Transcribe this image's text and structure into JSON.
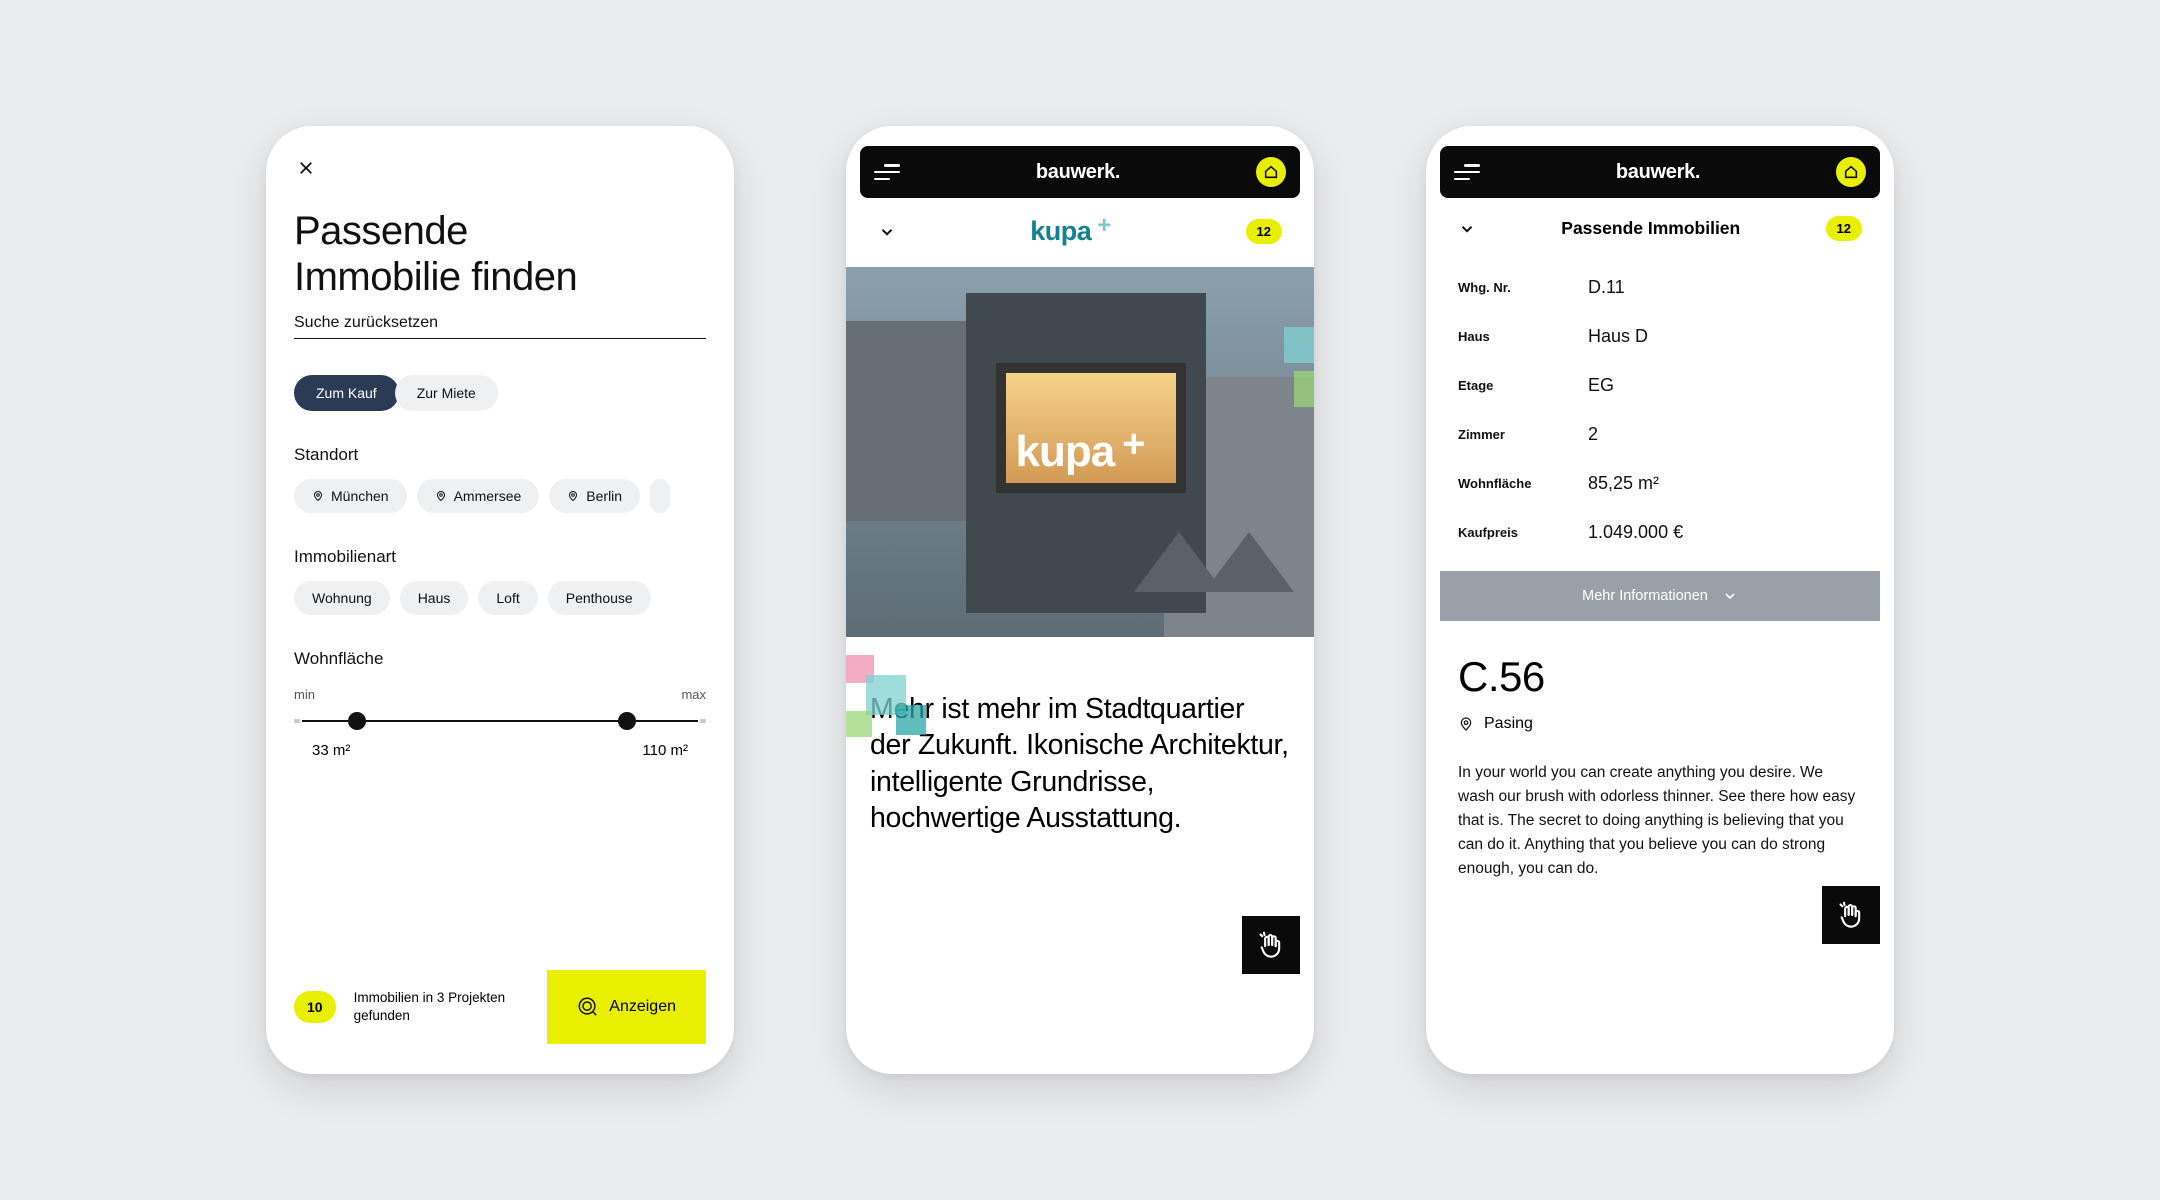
{
  "brand": "bauwerk.",
  "accent": "#e9ef00",
  "phone1": {
    "title_line1": "Passende",
    "title_line2": "Immobilie finden",
    "reset": "Suche zurücksetzen",
    "toggle_buy": "Zum Kauf",
    "toggle_rent": "Zur Miete",
    "section_location": "Standort",
    "locations": [
      "München",
      "Ammersee",
      "Berlin"
    ],
    "section_type": "Immobilienart",
    "types": [
      "Wohnung",
      "Haus",
      "Loft",
      "Penthouse"
    ],
    "section_area": "Wohnfläche",
    "min_label": "min",
    "max_label": "max",
    "area_min": "33 m²",
    "area_max": "110 m²",
    "result_count": "10",
    "result_text": "Immobilien in 3 Projekten gefunden",
    "show_label": "Anzeigen"
  },
  "phone2": {
    "project_name": "kupa",
    "badge": "12",
    "headline": "Mehr ist mehr im Stadtquartier der Zukunft. Ikonische Architektur, intelligente Grundrisse, hochwertige Ausstattung."
  },
  "phone3": {
    "subtitle": "Passende Immobilien",
    "badge": "12",
    "fields": {
      "whg_nr_k": "Whg. Nr.",
      "whg_nr_v": "D.11",
      "haus_k": "Haus",
      "haus_v": "Haus D",
      "etage_k": "Etage",
      "etage_v": "EG",
      "zimmer_k": "Zimmer",
      "zimmer_v": "2",
      "flaeche_k": "Wohnfläche",
      "flaeche_v": "85,25 m²",
      "preis_k": "Kaufpreis",
      "preis_v": "1.049.000 €"
    },
    "more": "Mehr Informationen",
    "unit": "C.56",
    "location": "Pasing",
    "description": "In your world you can create anything you desire. We wash our brush with odorless thinner. See there how easy that is. The secret to doing anything is believing that you can do it. Anything that you believe you can do strong enough, you can do."
  }
}
